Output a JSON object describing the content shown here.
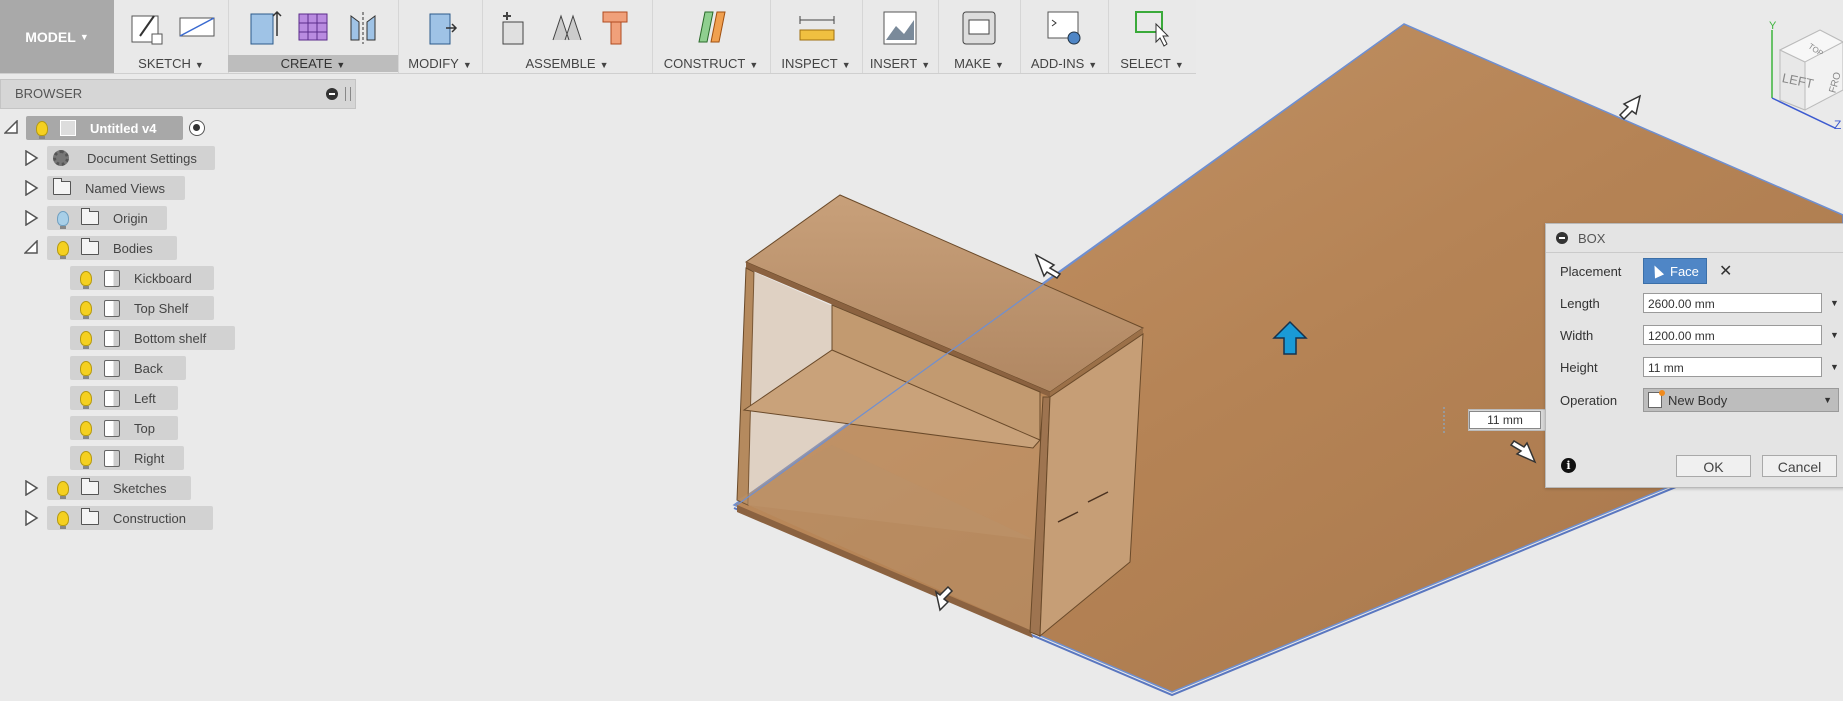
{
  "toolbar": {
    "model_label": "MODEL",
    "groups": [
      {
        "label": "SKETCH"
      },
      {
        "label": "CREATE"
      },
      {
        "label": "MODIFY"
      },
      {
        "label": "ASSEMBLE"
      },
      {
        "label": "CONSTRUCT"
      },
      {
        "label": "INSPECT"
      },
      {
        "label": "INSERT"
      },
      {
        "label": "MAKE"
      },
      {
        "label": "ADD-INS"
      },
      {
        "label": "SELECT"
      }
    ]
  },
  "browser": {
    "title": "BROWSER",
    "root": "Untitled v4",
    "items": [
      {
        "label": "Document Settings"
      },
      {
        "label": "Named Views"
      },
      {
        "label": "Origin"
      },
      {
        "label": "Bodies"
      }
    ],
    "bodies": [
      {
        "label": "Kickboard"
      },
      {
        "label": "Top Shelf"
      },
      {
        "label": "Bottom shelf"
      },
      {
        "label": "Back"
      },
      {
        "label": "Left"
      },
      {
        "label": "Top"
      },
      {
        "label": "Right"
      }
    ],
    "tail_items": [
      {
        "label": "Sketches"
      },
      {
        "label": "Construction"
      }
    ]
  },
  "dialog": {
    "title": "BOX",
    "placement_label": "Placement",
    "placement_value": "Face",
    "length_label": "Length",
    "length_value": "2600.00 mm",
    "width_label": "Width",
    "width_value": "1200.00 mm",
    "height_label": "Height",
    "height_value": "11 mm",
    "operation_label": "Operation",
    "operation_value": "New Body",
    "ok_label": "OK",
    "cancel_label": "Cancel"
  },
  "viewport": {
    "dimension_value": "11 mm",
    "viewcube_labels": {
      "left": "LEFT",
      "top": "TOP",
      "front": "FRO"
    },
    "axis_labels": {
      "y": "Y",
      "z": "Z"
    }
  },
  "colors": {
    "wood_top": "#b8865a",
    "wood_side": "#a8774e",
    "accent_blue": "#4f86c6",
    "model_button": "#a9a9a9"
  }
}
